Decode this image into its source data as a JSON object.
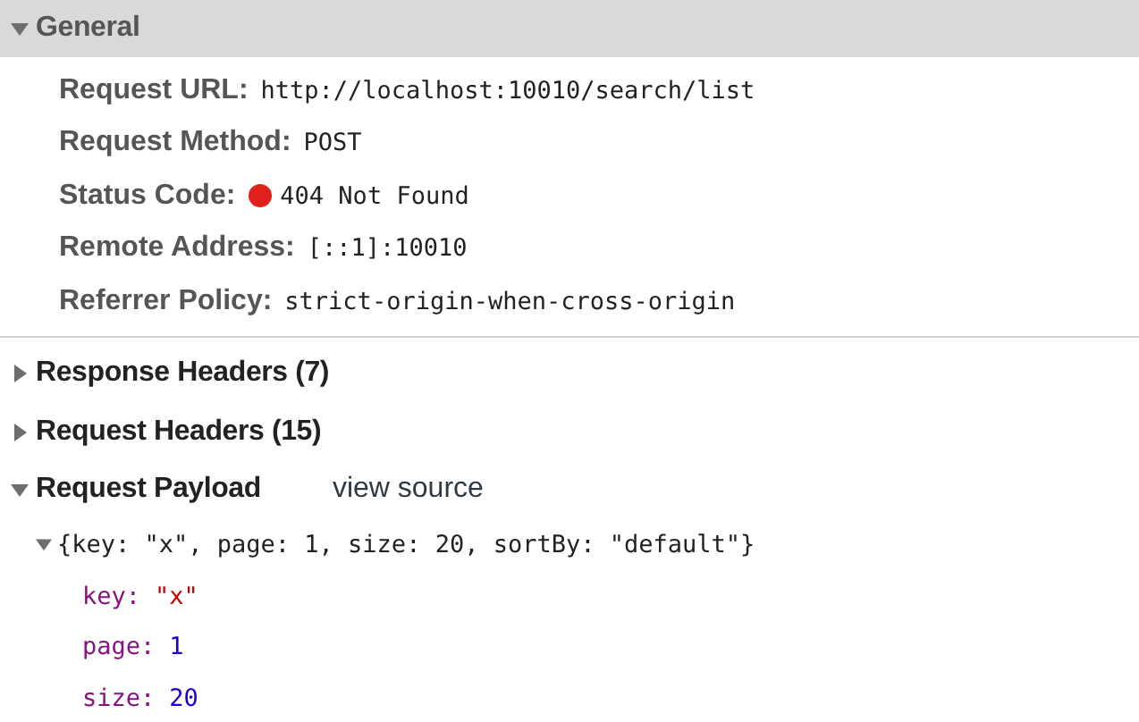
{
  "sections": [
    {
      "title": "General",
      "expanded": true,
      "selected": true,
      "fields": [
        {
          "label": "Request URL:",
          "value": "http://localhost:10010/search/list"
        },
        {
          "label": "Request Method:",
          "value": "POST"
        },
        {
          "label": "Status Code:",
          "value": "404 Not Found",
          "color": "#e0201b"
        },
        {
          "label": "Remote Address:",
          "value": "[::1]:10010"
        },
        {
          "label": "Referrer Policy:",
          "value": "strict-origin-when-cross-origin"
        }
      ]
    },
    {
      "title": "Response Headers (7)",
      "expanded": false,
      "selected": false
    },
    {
      "title": "Request Headers (15)",
      "expanded": false,
      "selected": false
    },
    {
      "title": "Request Payload",
      "expanded": true,
      "selected": false,
      "link": "view source",
      "payload": {
        "summary": "{key: \"x\", page: 1, size: 20, sortBy: \"default\"}",
        "expanded": true,
        "properties": [
          {
            "key": "key:",
            "value": "\"x\"",
            "kind": "string"
          },
          {
            "key": "page:",
            "value": "1",
            "kind": "number"
          },
          {
            "key": "size:",
            "value": "20",
            "kind": "number"
          }
        ]
      }
    }
  ]
}
